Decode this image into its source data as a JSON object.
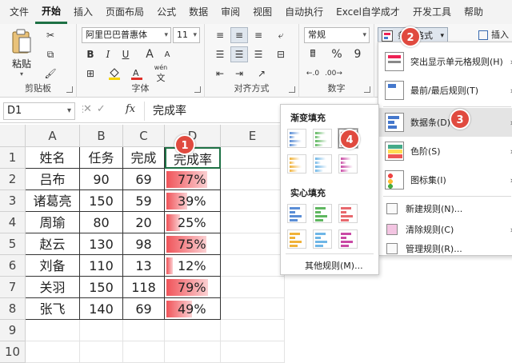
{
  "tabs": [
    "文件",
    "开始",
    "插入",
    "页面布局",
    "公式",
    "数据",
    "审阅",
    "视图",
    "自动执行",
    "Excel自学成才",
    "开发工具",
    "帮助"
  ],
  "active_tab": "开始",
  "ribbon": {
    "clipboard": {
      "paste_label": "粘贴",
      "group_label": "剪贴板"
    },
    "font": {
      "font_name": "阿里巴巴普惠体",
      "font_size": "11",
      "group_label": "字体",
      "bold": "B",
      "italic": "I",
      "underline": "U",
      "grow": "A",
      "shrink": "A",
      "wen": "wén"
    },
    "alignment": {
      "group_label": "对齐方式"
    },
    "number": {
      "format": "常规",
      "percent": "%",
      "comma": "9",
      "group_label": "数字"
    },
    "styles": {
      "cond_format_label": "条件格式"
    },
    "cells": {
      "insert_label": "插入"
    }
  },
  "formula_bar": {
    "name_box": "D1",
    "fx": "fx",
    "content": "完成率"
  },
  "columns": [
    "A",
    "B",
    "C",
    "D",
    "E"
  ],
  "rows": [
    "1",
    "2",
    "3",
    "4",
    "5",
    "6",
    "7",
    "8",
    "9",
    "10"
  ],
  "table": {
    "headers": [
      "姓名",
      "任务",
      "完成",
      "完成率"
    ],
    "data": [
      [
        "吕布",
        "90",
        "69",
        "77%"
      ],
      [
        "诸葛亮",
        "150",
        "59",
        "39%"
      ],
      [
        "周瑜",
        "80",
        "20",
        "25%"
      ],
      [
        "赵云",
        "130",
        "98",
        "75%"
      ],
      [
        "刘备",
        "110",
        "13",
        "12%"
      ],
      [
        "关羽",
        "150",
        "118",
        "79%"
      ],
      [
        "张飞",
        "140",
        "69",
        "49%"
      ]
    ],
    "rate_values": [
      0.77,
      0.39,
      0.25,
      0.75,
      0.12,
      0.79,
      0.49
    ]
  },
  "cond_menu": {
    "items": [
      "突出显示单元格规则(H)",
      "最前/最后规则(T)",
      "数据条(D)",
      "色阶(S)",
      "图标集(I)"
    ],
    "small_items": [
      "新建规则(N)...",
      "清除规则(C)",
      "管理规则(R)..."
    ],
    "highlighted": "数据条(D)"
  },
  "databar_submenu": {
    "gradient_title": "渐变填充",
    "solid_title": "实心填充",
    "more_rules": "其他规则(M)...",
    "swatch_colors": [
      "#5b8ed6",
      "#5fb760",
      "#e8686e",
      "#f0b23a",
      "#6fb6e6",
      "#c94aa5"
    ]
  },
  "badges": [
    "1",
    "2",
    "3",
    "4"
  ],
  "colors": {
    "accent": "#1e7145",
    "databar": "#f0545a",
    "badge": "#e04a3f"
  }
}
